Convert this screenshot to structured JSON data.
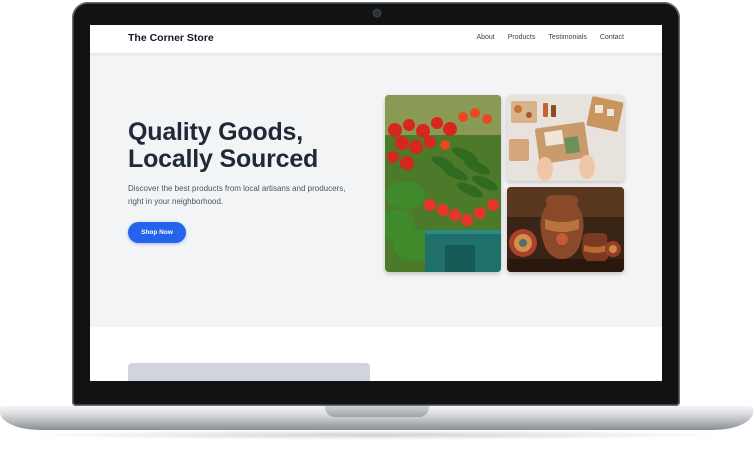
{
  "brand": "The Corner Store",
  "nav": {
    "links": [
      "About",
      "Products",
      "Testimonials",
      "Contact"
    ]
  },
  "hero": {
    "title_line1": "Quality Goods,",
    "title_line2": "Locally Sourced",
    "subtitle_line1": "Discover the best products from local artisans and producers,",
    "subtitle_line2": "right in your neighborhood.",
    "cta_label": "Shop Now"
  },
  "colors": {
    "accent": "#2563eb",
    "page_bg": "#f3f4f6",
    "heading": "#1f2937"
  },
  "images": [
    {
      "name": "produce-market-image"
    },
    {
      "name": "handmade-crafts-image"
    },
    {
      "name": "pottery-image"
    }
  ]
}
